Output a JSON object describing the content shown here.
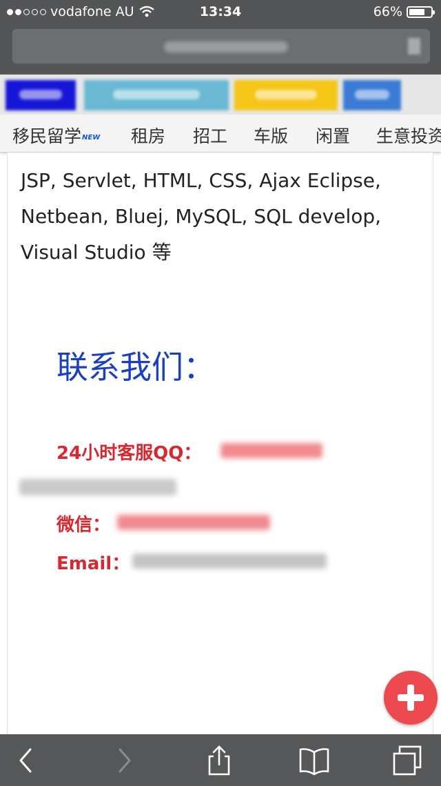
{
  "status": {
    "carrier": "vodafone AU",
    "time": "13:34",
    "battery": "66%",
    "battery_level": 0.66
  },
  "category_nav": {
    "items": [
      {
        "label": "移民留学",
        "badge": "NEW"
      },
      {
        "label": "租房"
      },
      {
        "label": "招工"
      },
      {
        "label": "车版"
      },
      {
        "label": "闲置"
      },
      {
        "label": "生意投资"
      }
    ]
  },
  "content": {
    "tech_lines": [
      "JSP, Servlet, HTML, CSS, Ajax Eclipse,",
      "Netbean, Bluej, MySQL, SQL develop,",
      "Visual Studio 等"
    ],
    "contact_title": "联系我们：",
    "qq_label": "24小时客服QQ：",
    "wechat_label": "微信：",
    "email_label": "Email："
  },
  "colors": {
    "chrome": "#535557",
    "title_blue": "#1a3fbf",
    "label_red": "#d7282f",
    "fab_red": "#ec4a4f"
  },
  "icons": {
    "back": "chevron-left-icon",
    "forward": "chevron-right-icon",
    "share": "share-icon",
    "bookmarks": "book-icon",
    "tabs": "tabs-icon",
    "fab": "plus-icon"
  }
}
